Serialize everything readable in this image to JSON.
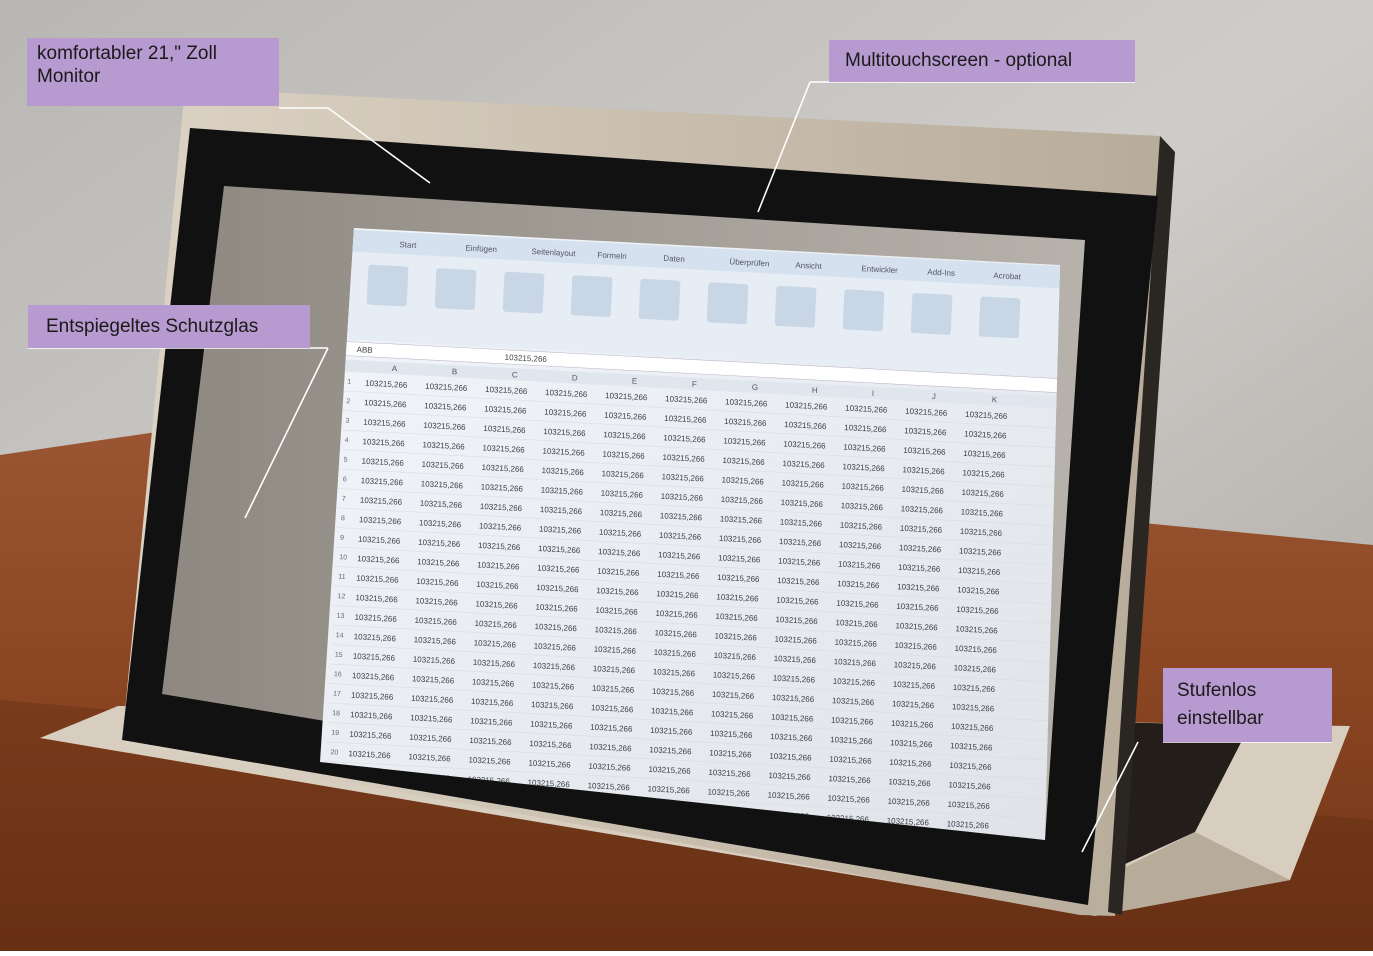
{
  "callouts": {
    "monitor": "komfortabler 21,\" Zoll Monitor",
    "touch": "Multitouchscreen - optional",
    "glass": "Entspiegeltes Schutzglas",
    "stepless_line1": "Stufenlos",
    "stepless_line2": "einstellbar"
  },
  "colors": {
    "callout_bg": "#b79ad0",
    "leader_line": "#ffffff",
    "bezel": "#111111",
    "frame_metal": "#cfc4b4",
    "desk_wood": "#8a4522",
    "wall": "#c2bfba"
  },
  "spreadsheet": {
    "name_box": "ABB",
    "formula": "103215,266",
    "tabs": [
      "Start",
      "Einfügen",
      "Seitenlayout",
      "Formeln",
      "Daten",
      "Überprüfen",
      "Ansicht",
      "Entwickler",
      "Add-Ins",
      "Acrobat"
    ],
    "columns": [
      "A",
      "B",
      "C",
      "D",
      "E",
      "F",
      "G",
      "H",
      "I",
      "J",
      "K"
    ],
    "cell_value": "103215,266",
    "row_count": 25
  }
}
